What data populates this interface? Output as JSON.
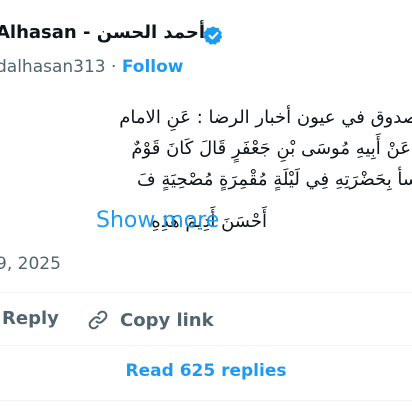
{
  "author": {
    "display_name": "Alhasan - أحمد الحسن",
    "handle": "dalhasan313",
    "separator": "·",
    "follow_label": "Follow"
  },
  "tweet": {
    "lines": [
      "صدوق في عيون أخبار الرضا : عَنِ الامام",
      "(عَنْ أَبِيهِ مُوسَى بْنِ جَعْفَرٍ قَالَ كَانَ قَوْمٌ",
      "سأ بِحَضْرَتِهِ فِي لَيْلَةٍ مُقْمِرَةٍ مُصْحِيَةٍ فَ",
      "أَحْسَنَ أَدِيمَ هَذِهِ"
    ],
    "show_more_label": "Show more"
  },
  "date": "9, 2025",
  "actions": {
    "reply_label": "Reply",
    "copy_link_label": "Copy link"
  },
  "read_replies_label": "Read 625 replies",
  "colors": {
    "accent": "#1d9bf0",
    "text": "#0f1419",
    "muted": "#536471",
    "divider": "#eff3f4"
  }
}
